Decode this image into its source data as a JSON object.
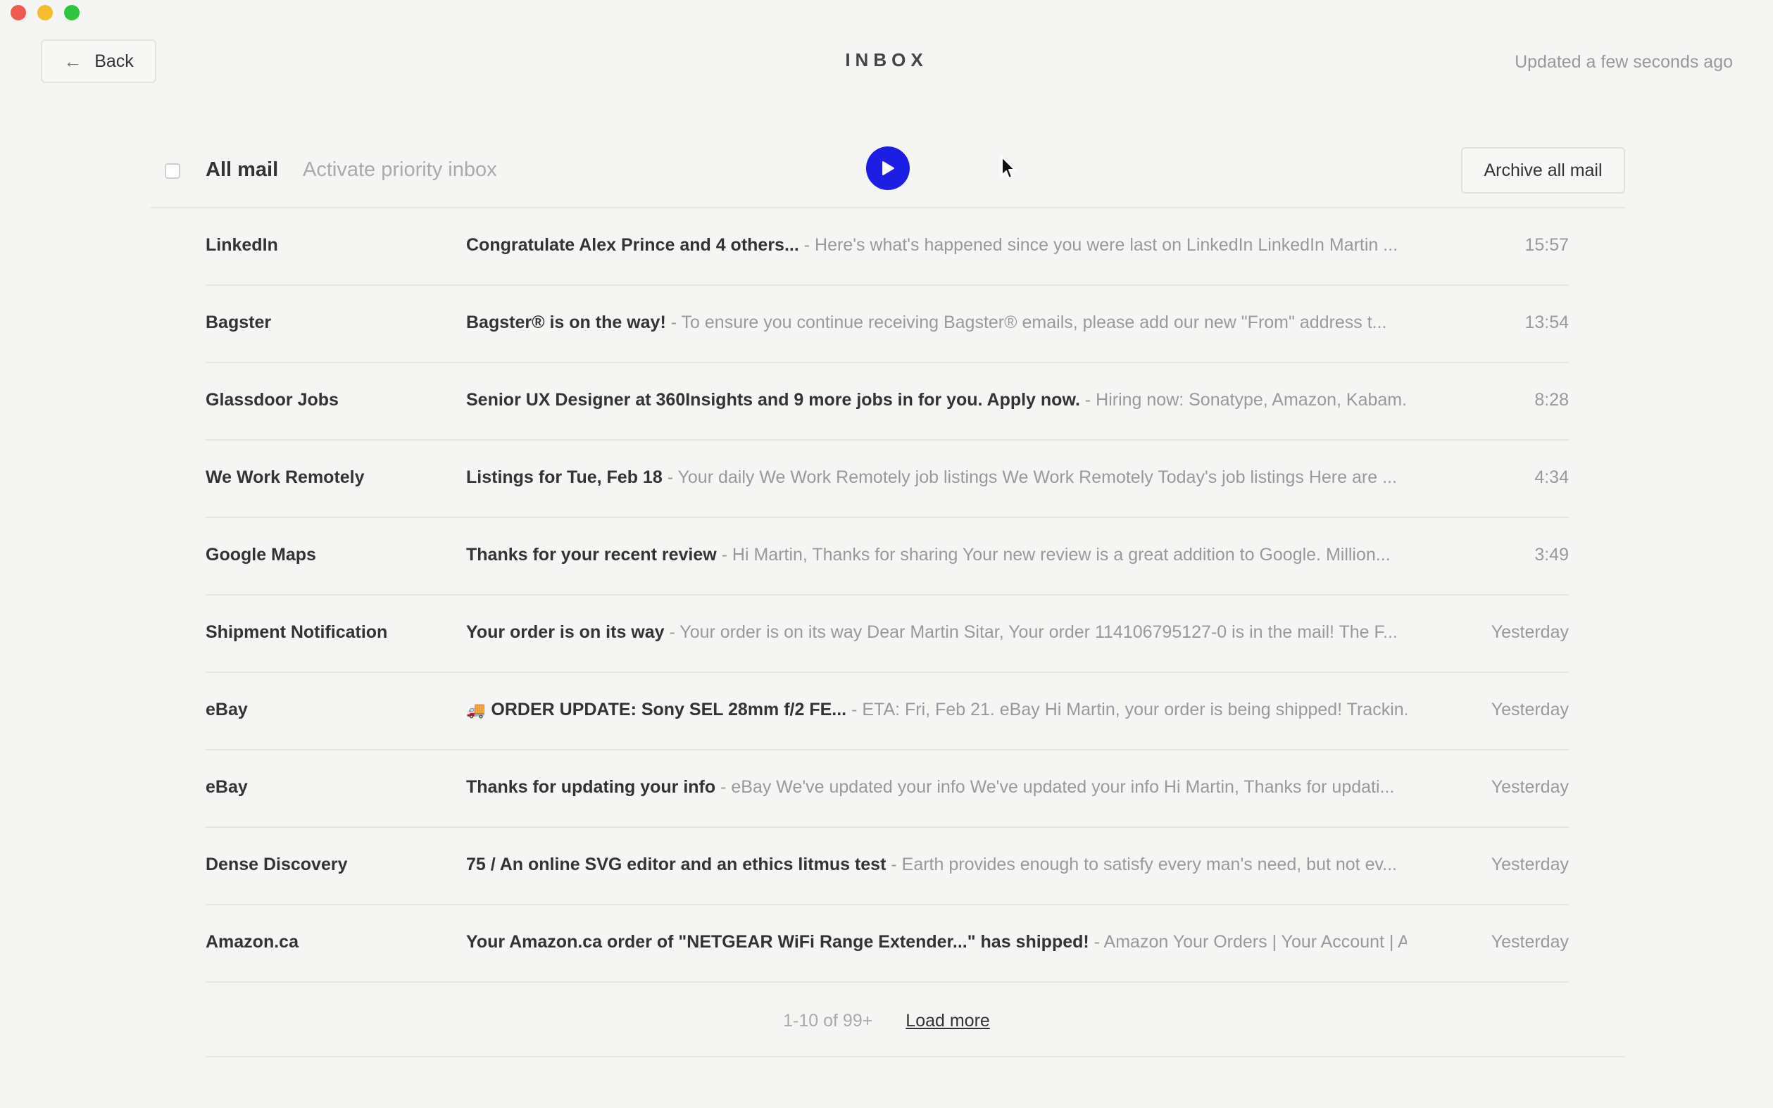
{
  "header": {
    "back_label": "Back",
    "title": "INBOX",
    "updated": "Updated a few seconds ago"
  },
  "toolbar": {
    "all_mail": "All mail",
    "priority": "Activate priority inbox",
    "archive_all": "Archive all mail"
  },
  "emails": [
    {
      "sender": "LinkedIn",
      "subject": "Congratulate Alex Prince and 4 others...",
      "snippet": " - Here's what's happened since you were last on LinkedIn LinkedIn Martin ...",
      "time": "15:57"
    },
    {
      "sender": "Bagster",
      "subject": "Bagster® is on the way!",
      "snippet": " - To ensure you continue receiving Bagster® emails, please add our new \"From\" address t...",
      "time": "13:54"
    },
    {
      "sender": "Glassdoor Jobs",
      "subject": "Senior UX Designer at 360Insights and 9 more jobs in for you. Apply now.",
      "snippet": " - Hiring now: Sonatype, Amazon, Kabam...",
      "time": "8:28"
    },
    {
      "sender": "We Work Remotely",
      "subject": "Listings for Tue, Feb 18",
      "snippet": " - Your daily We Work Remotely job listings We Work Remotely Today's job listings Here are ...",
      "time": "4:34"
    },
    {
      "sender": "Google Maps",
      "subject": "Thanks for your recent review",
      "snippet": " - Hi Martin, Thanks for sharing Your new review is a great addition to Google. Million...",
      "time": "3:49"
    },
    {
      "sender": "Shipment Notification",
      "subject": "Your order is on its way",
      "snippet": " - Your order is on its way Dear Martin Sitar, Your order 114106795127-0 is in the mail! The F...",
      "time": "Yesterday"
    },
    {
      "sender": "eBay",
      "emoji": "🚚",
      "subject": "ORDER UPDATE: Sony SEL 28mm f/2 FE...",
      "snippet": " - ETA: Fri, Feb 21. eBay Hi Martin, your order is being shipped! Trackin...",
      "time": "Yesterday"
    },
    {
      "sender": "eBay",
      "subject": "Thanks for updating your info",
      "snippet": " - eBay We've updated your info We've updated your info Hi Martin, Thanks for updati...",
      "time": "Yesterday"
    },
    {
      "sender": "Dense Discovery",
      "subject": "75 / An online SVG editor and an ethics litmus test",
      "snippet": " - Earth provides enough to satisfy every man's need, but not ev...",
      "time": "Yesterday"
    },
    {
      "sender": "Amazon.ca",
      "subject": "Your Amazon.ca order of \"NETGEAR WiFi Range Extender...\" has shipped!",
      "snippet": " - Amazon Your Orders | Your Account | A...",
      "time": "Yesterday"
    }
  ],
  "pager": {
    "count": "1-10 of 99+",
    "load_more": "Load more"
  },
  "colors": {
    "accent": "#1c1fe3",
    "background": "#f5f5f3"
  },
  "icons": {
    "back": "arrow-left-icon",
    "play": "play-icon",
    "cursor": "mouse-pointer-icon"
  }
}
